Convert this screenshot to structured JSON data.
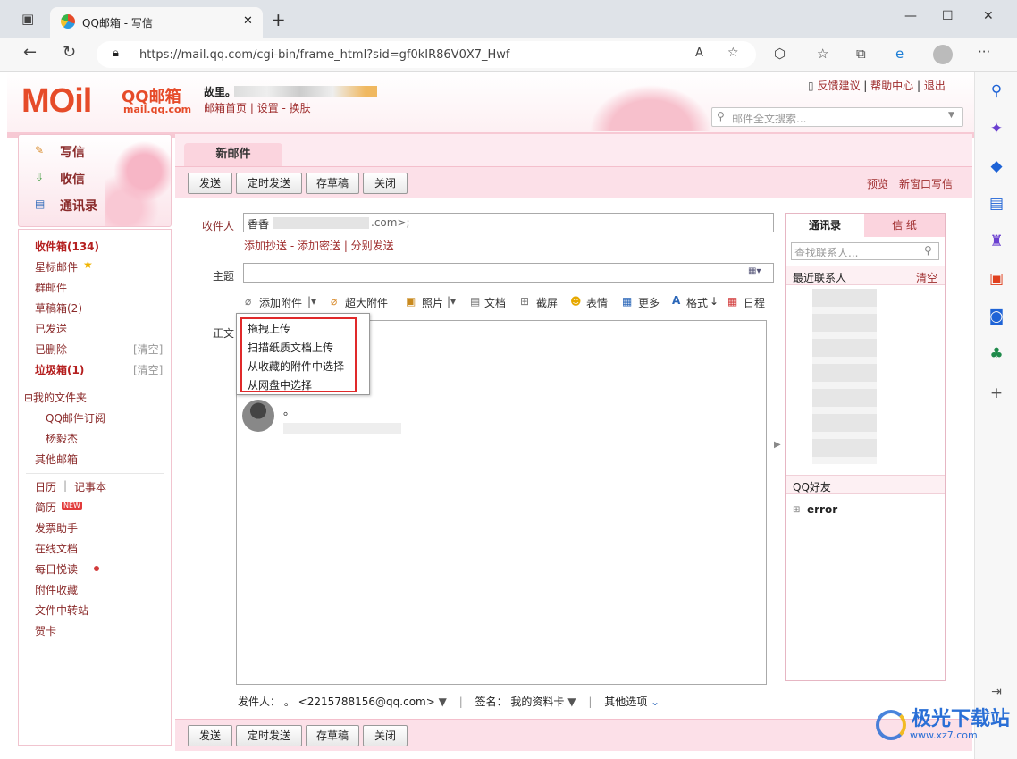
{
  "browser": {
    "tab_title": "QQ邮箱 - 写信",
    "url": "https://mail.qq.com/cgi-bin/frame_html?sid=gf0kIR86V0X7_Hwf",
    "close": "✕",
    "new_tab": "+"
  },
  "header": {
    "logo_text": "MOil",
    "logo_cn": "QQ邮箱",
    "logo_en": "mail.qq.com",
    "user": "故里。",
    "links": [
      "邮箱首页",
      "设置",
      "换肤"
    ],
    "top_links": [
      "反馈建议",
      "帮助中心",
      "退出"
    ],
    "search_placeholder": "邮件全文搜索..."
  },
  "left": {
    "top": [
      "写信",
      "收信",
      "通讯录"
    ],
    "nav": [
      "收件箱(134)",
      "星标邮件",
      "群邮件",
      "草稿箱(2)",
      "已发送",
      "已删除",
      "垃圾箱(1)"
    ],
    "clear": "[清空]",
    "folders": [
      "⊟我的文件夹",
      "QQ邮件订阅",
      "杨毅杰",
      "其他邮箱"
    ],
    "apps": [
      "日历",
      "记事本",
      "简历",
      "发票助手",
      "在线文档",
      "每日悦读",
      "附件收藏",
      "文件中转站",
      "贺卡"
    ],
    "new_badge": "NEW"
  },
  "compose": {
    "tab": "新邮件",
    "buttons": [
      "发送",
      "定时发送",
      "存草稿",
      "关闭"
    ],
    "preview": "预览",
    "new_window": "新窗口写信",
    "to_label": "收件人",
    "to_value": "香香",
    "to_suffix": ".com>;",
    "cc_links": [
      "添加抄送",
      "添加密送",
      "分别发送"
    ],
    "subject_label": "主题",
    "body_label": "正文",
    "tools": [
      "添加附件",
      "超大附件",
      "照片",
      "文档",
      "截屏",
      "表情",
      "更多",
      "格式",
      "日程"
    ],
    "attach_menu": [
      "拖拽上传",
      "扫描纸质文档上传",
      "从收藏的附件中选择",
      "从网盘中选择"
    ],
    "signature_dot": "。",
    "footer": {
      "sender_label": "发件人：",
      "sender": "。 <2215788156@qq.com>",
      "sign_label": "签名：",
      "sign": "我的资料卡",
      "options": "其他选项"
    }
  },
  "contacts": {
    "tabs": [
      "通讯录",
      "信 纸"
    ],
    "search_placeholder": "查找联系人...",
    "recent": "最近联系人",
    "clear": "清空",
    "group": "QQ好友",
    "error": "error"
  },
  "watermark": {
    "name": "极光下载站",
    "site": "www.xz7.com"
  }
}
